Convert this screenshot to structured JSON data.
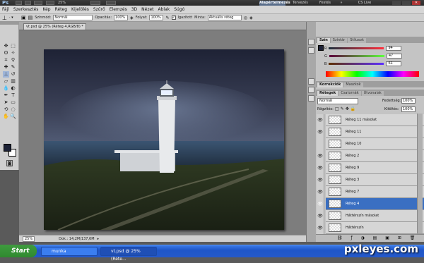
{
  "app": {
    "logo_text": "Ps",
    "zoom": "25%",
    "workspaces": [
      "Alapértelmezés",
      "Tervezés",
      "Festés"
    ],
    "cs_live": "CS Live"
  },
  "menu": [
    "Fájl",
    "Szerkesztés",
    "Kép",
    "Réteg",
    "Kijelölés",
    "Szűrő",
    "Elemzés",
    "3D",
    "Nézet",
    "Ablak",
    "Súgó"
  ],
  "options": {
    "mode_label": "Színmód:",
    "mode_value": "Normál",
    "opacity_label": "Opacitás:",
    "opacity_value": "100%",
    "flow_label": "Folyat:",
    "flow_value": "100%",
    "aligned_label": "Igazított",
    "sample_label": "Minta:",
    "sample_value": "Aktuális réteg"
  },
  "document": {
    "tab_title": "vt.psd @ 25% (Réteg 4,RGB/8) *"
  },
  "status": {
    "zoom": "25%",
    "doc_info": "Dok.: 14,2M/137,6M"
  },
  "color_panel": {
    "tabs": [
      "Szín",
      "Színtár",
      "Stílusok"
    ],
    "r": "94",
    "g": "47",
    "b": "61"
  },
  "adjust_tabs": [
    "Korrekciók",
    "Maszkok"
  ],
  "layers_panel": {
    "tabs": [
      "Rétegek",
      "Csatornák",
      "Útvonalak"
    ],
    "blend_mode": "Normál",
    "opacity_label": "Fedettség:",
    "opacity_value": "100%",
    "lock_label": "Rögzítés:",
    "fill_label": "Kitöltés:",
    "fill_value": "100%",
    "layers": [
      {
        "name": "Réteg 11 másolat",
        "visible": true,
        "selected": false
      },
      {
        "name": "Réteg 11",
        "visible": true,
        "selected": false
      },
      {
        "name": "Réteg 10",
        "visible": false,
        "selected": false
      },
      {
        "name": "Réteg 2",
        "visible": true,
        "selected": false
      },
      {
        "name": "Réteg 9",
        "visible": true,
        "selected": false
      },
      {
        "name": "Réteg 3",
        "visible": true,
        "selected": false
      },
      {
        "name": "Réteg 7",
        "visible": true,
        "selected": false
      },
      {
        "name": "Réteg 4",
        "visible": true,
        "selected": true
      },
      {
        "name": "Háttérszín másolat",
        "visible": true,
        "selected": false
      },
      {
        "name": "Háttérszín",
        "visible": true,
        "selected": false
      }
    ]
  },
  "taskbar": {
    "start": "Start",
    "items": [
      "munka",
      "vt.psd @ 25% (Réte..."
    ]
  },
  "watermark": "pxleyes.com",
  "colors": {
    "selected_layer": "#3a6fc2",
    "foreground": "#1c2136",
    "background": "#ffffff"
  }
}
